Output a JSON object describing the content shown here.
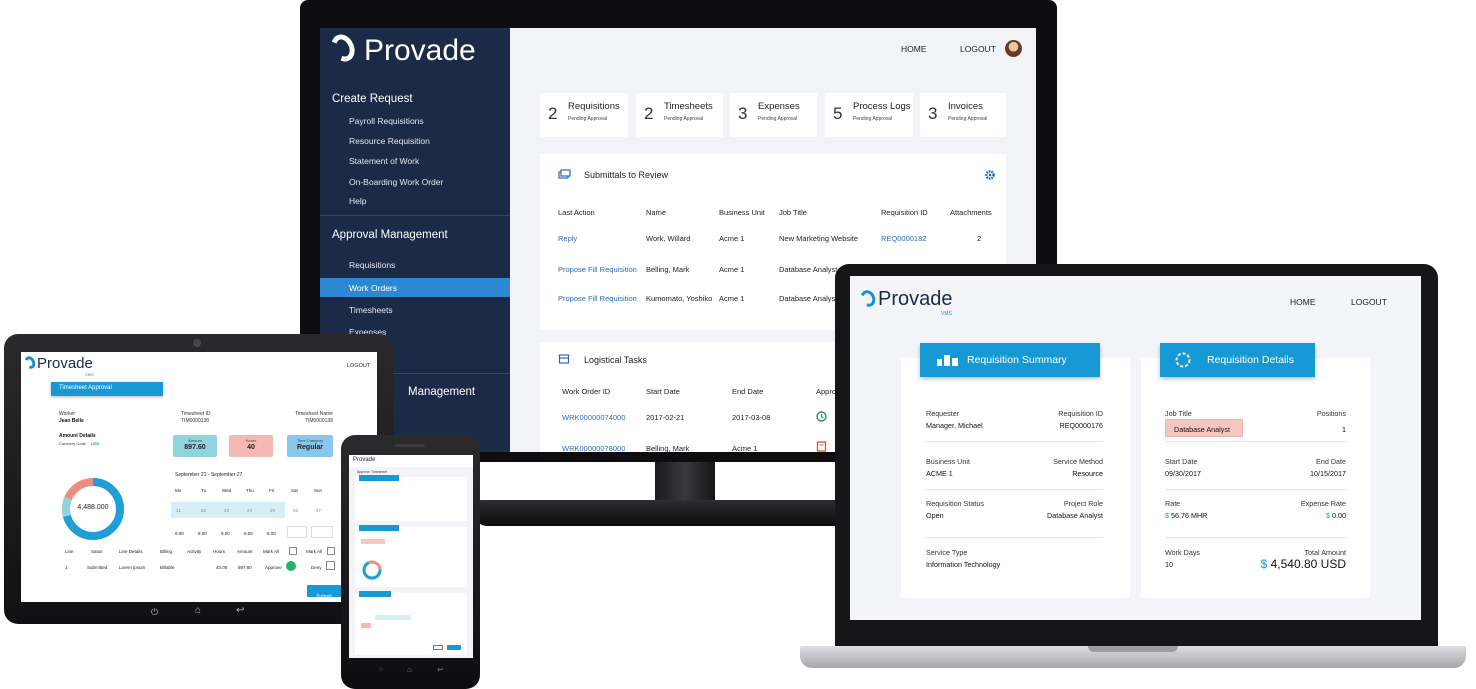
{
  "monitor": {
    "brand": "Provade",
    "nav": {
      "home": "HOME",
      "logout": "LOGOUT"
    },
    "sidebar": {
      "sections": [
        {
          "title": "Create Request",
          "items": [
            "Payroll Requisitions",
            "Resource Requisition",
            "Statement of Work",
            "On-Boarding Work Order",
            "Help"
          ]
        },
        {
          "title": "Approval Management",
          "items": [
            "Requisitions",
            "Work Orders",
            "Timesheets",
            "Expenses"
          ]
        },
        {
          "title": "Management",
          "items": []
        }
      ],
      "selected_item": "Work Orders"
    },
    "stats": [
      {
        "count": "2",
        "label": "Requisitions",
        "sub": "Pending Approval"
      },
      {
        "count": "2",
        "label": "Timesheets",
        "sub": "Pending Approval"
      },
      {
        "count": "3",
        "label": "Expenses",
        "sub": "Pending Approval"
      },
      {
        "count": "5",
        "label": "Process Logs",
        "sub": "Pending Approval"
      },
      {
        "count": "3",
        "label": "Invoices",
        "sub": "Pending Approval"
      }
    ],
    "submittals": {
      "title": "Submittals to Review",
      "columns": [
        "Last Action",
        "Name",
        "Business Unit",
        "Job Title",
        "Requisition ID",
        "Attachments"
      ],
      "rows": [
        {
          "action": "Reply",
          "name": "Work, Willard",
          "unit": "Acme 1",
          "job": "New Marketing Website",
          "req": "REQ0000182",
          "attach": "2"
        },
        {
          "action": "Propose Fill Requisition",
          "name": "Belling, Mark",
          "unit": "Acme 1",
          "job": "Database Analyst",
          "req": "",
          "attach": ""
        },
        {
          "action": "Propose Fill Requisition",
          "name": "Kumomato, Yoshiko",
          "unit": "Acme 1",
          "job": "Database Analyst",
          "req": "",
          "attach": ""
        }
      ]
    },
    "tasks": {
      "title": "Logistical Tasks",
      "columns": [
        "Work Order ID",
        "Start Date",
        "End Date",
        "Approval"
      ],
      "rows": [
        {
          "id": "WRK00000074000",
          "c2": "2017-02-21",
          "c3": "2017-03-08"
        },
        {
          "id": "WRK00000078000",
          "c2": "Belling, Mark",
          "c3": "Acme 1"
        }
      ]
    }
  },
  "tablet": {
    "brand": "Provade",
    "brand_sub": "VMS",
    "logout": "LOGOUT",
    "panel_title": "Timesheet Approval",
    "worker_label": "Worker",
    "worker": "Jean Belle",
    "ts_id_label": "Timesheet ID",
    "ts_id": "TIM0000138",
    "ts_name_label": "Timesheet Name",
    "ts_name": "TIM0000138",
    "amount_details": "Amount Details",
    "currency_label": "Currency Code",
    "currency": "USD",
    "tiles": [
      {
        "label": "Amount",
        "value": "897.60",
        "color": "#8fd5dd"
      },
      {
        "label": "Hours",
        "value": "40",
        "color": "#f6b8b2"
      },
      {
        "label": "Time Category",
        "value": "Regular",
        "color": "#8ac7ee"
      }
    ],
    "donut_value": "4,488.000",
    "week": "September 21 - September 27",
    "days": [
      "Mo",
      "Tu",
      "Wed",
      "Thu",
      "Fri",
      "Sat",
      "Sun"
    ],
    "dates": [
      "21",
      "22",
      "23",
      "24",
      "25",
      "26",
      "27"
    ],
    "hours": [
      "8.00",
      "8.00",
      "8.00",
      "8.00",
      "8.00"
    ],
    "line_columns": [
      "Line",
      "Satus",
      "Line Details",
      "Billing",
      "Activity",
      "Hours",
      "Amount",
      "Mark All",
      "Mark All"
    ],
    "line_row": [
      "1",
      "Submitted",
      "Lorem Ipsum",
      "Billable",
      "",
      "40.00",
      "897.60"
    ],
    "approve": "Approve",
    "deny": "Deny",
    "submit": "Submit"
  },
  "phone": {
    "brand": "Provade",
    "title": "Approve Timesheet"
  },
  "laptop": {
    "brand": "Provade",
    "brand_sub": "VMS",
    "nav": {
      "home": "HOME",
      "logout": "LOGOUT"
    },
    "summary": {
      "title": "Requisition Summary",
      "rows": [
        {
          "k1": "Requester",
          "v1": "Manager, Michael",
          "k2": "Requisition ID",
          "v2": "REQ0000176"
        },
        {
          "k1": "Business Unit",
          "v1": "ACME 1",
          "k2": "Service Method",
          "v2": "Resource"
        },
        {
          "k1": "Requisition Status",
          "v1": "Open",
          "k2": "Project Role",
          "v2": "Database Analyst"
        },
        {
          "k1": "Service Type",
          "v1": "Information Technology",
          "k2": "",
          "v2": ""
        }
      ]
    },
    "details": {
      "title": "Requisition Details",
      "job_title_label": "Job Title",
      "job_title": "Database Analyst",
      "positions_label": "Positions",
      "positions": "1",
      "start_label": "Start Date",
      "start": "09/30/2017",
      "end_label": "End Date",
      "end": "10/15/2017",
      "rate_label": "Rate",
      "rate_symbol": "$",
      "rate": "56.76 MHR",
      "expense_label": "Expense Rate",
      "expense_symbol": "$",
      "expense": "0.00",
      "workdays_label": "Work Days",
      "workdays": "10",
      "total_label": "Total Amount",
      "total_symbol": "$",
      "total": "4,540.80 USD"
    }
  },
  "colors": {
    "sidebar": "#1b2a47",
    "accent_blue": "#1799d6",
    "link": "#2d6cb5",
    "highlight": "#2e87d2"
  }
}
